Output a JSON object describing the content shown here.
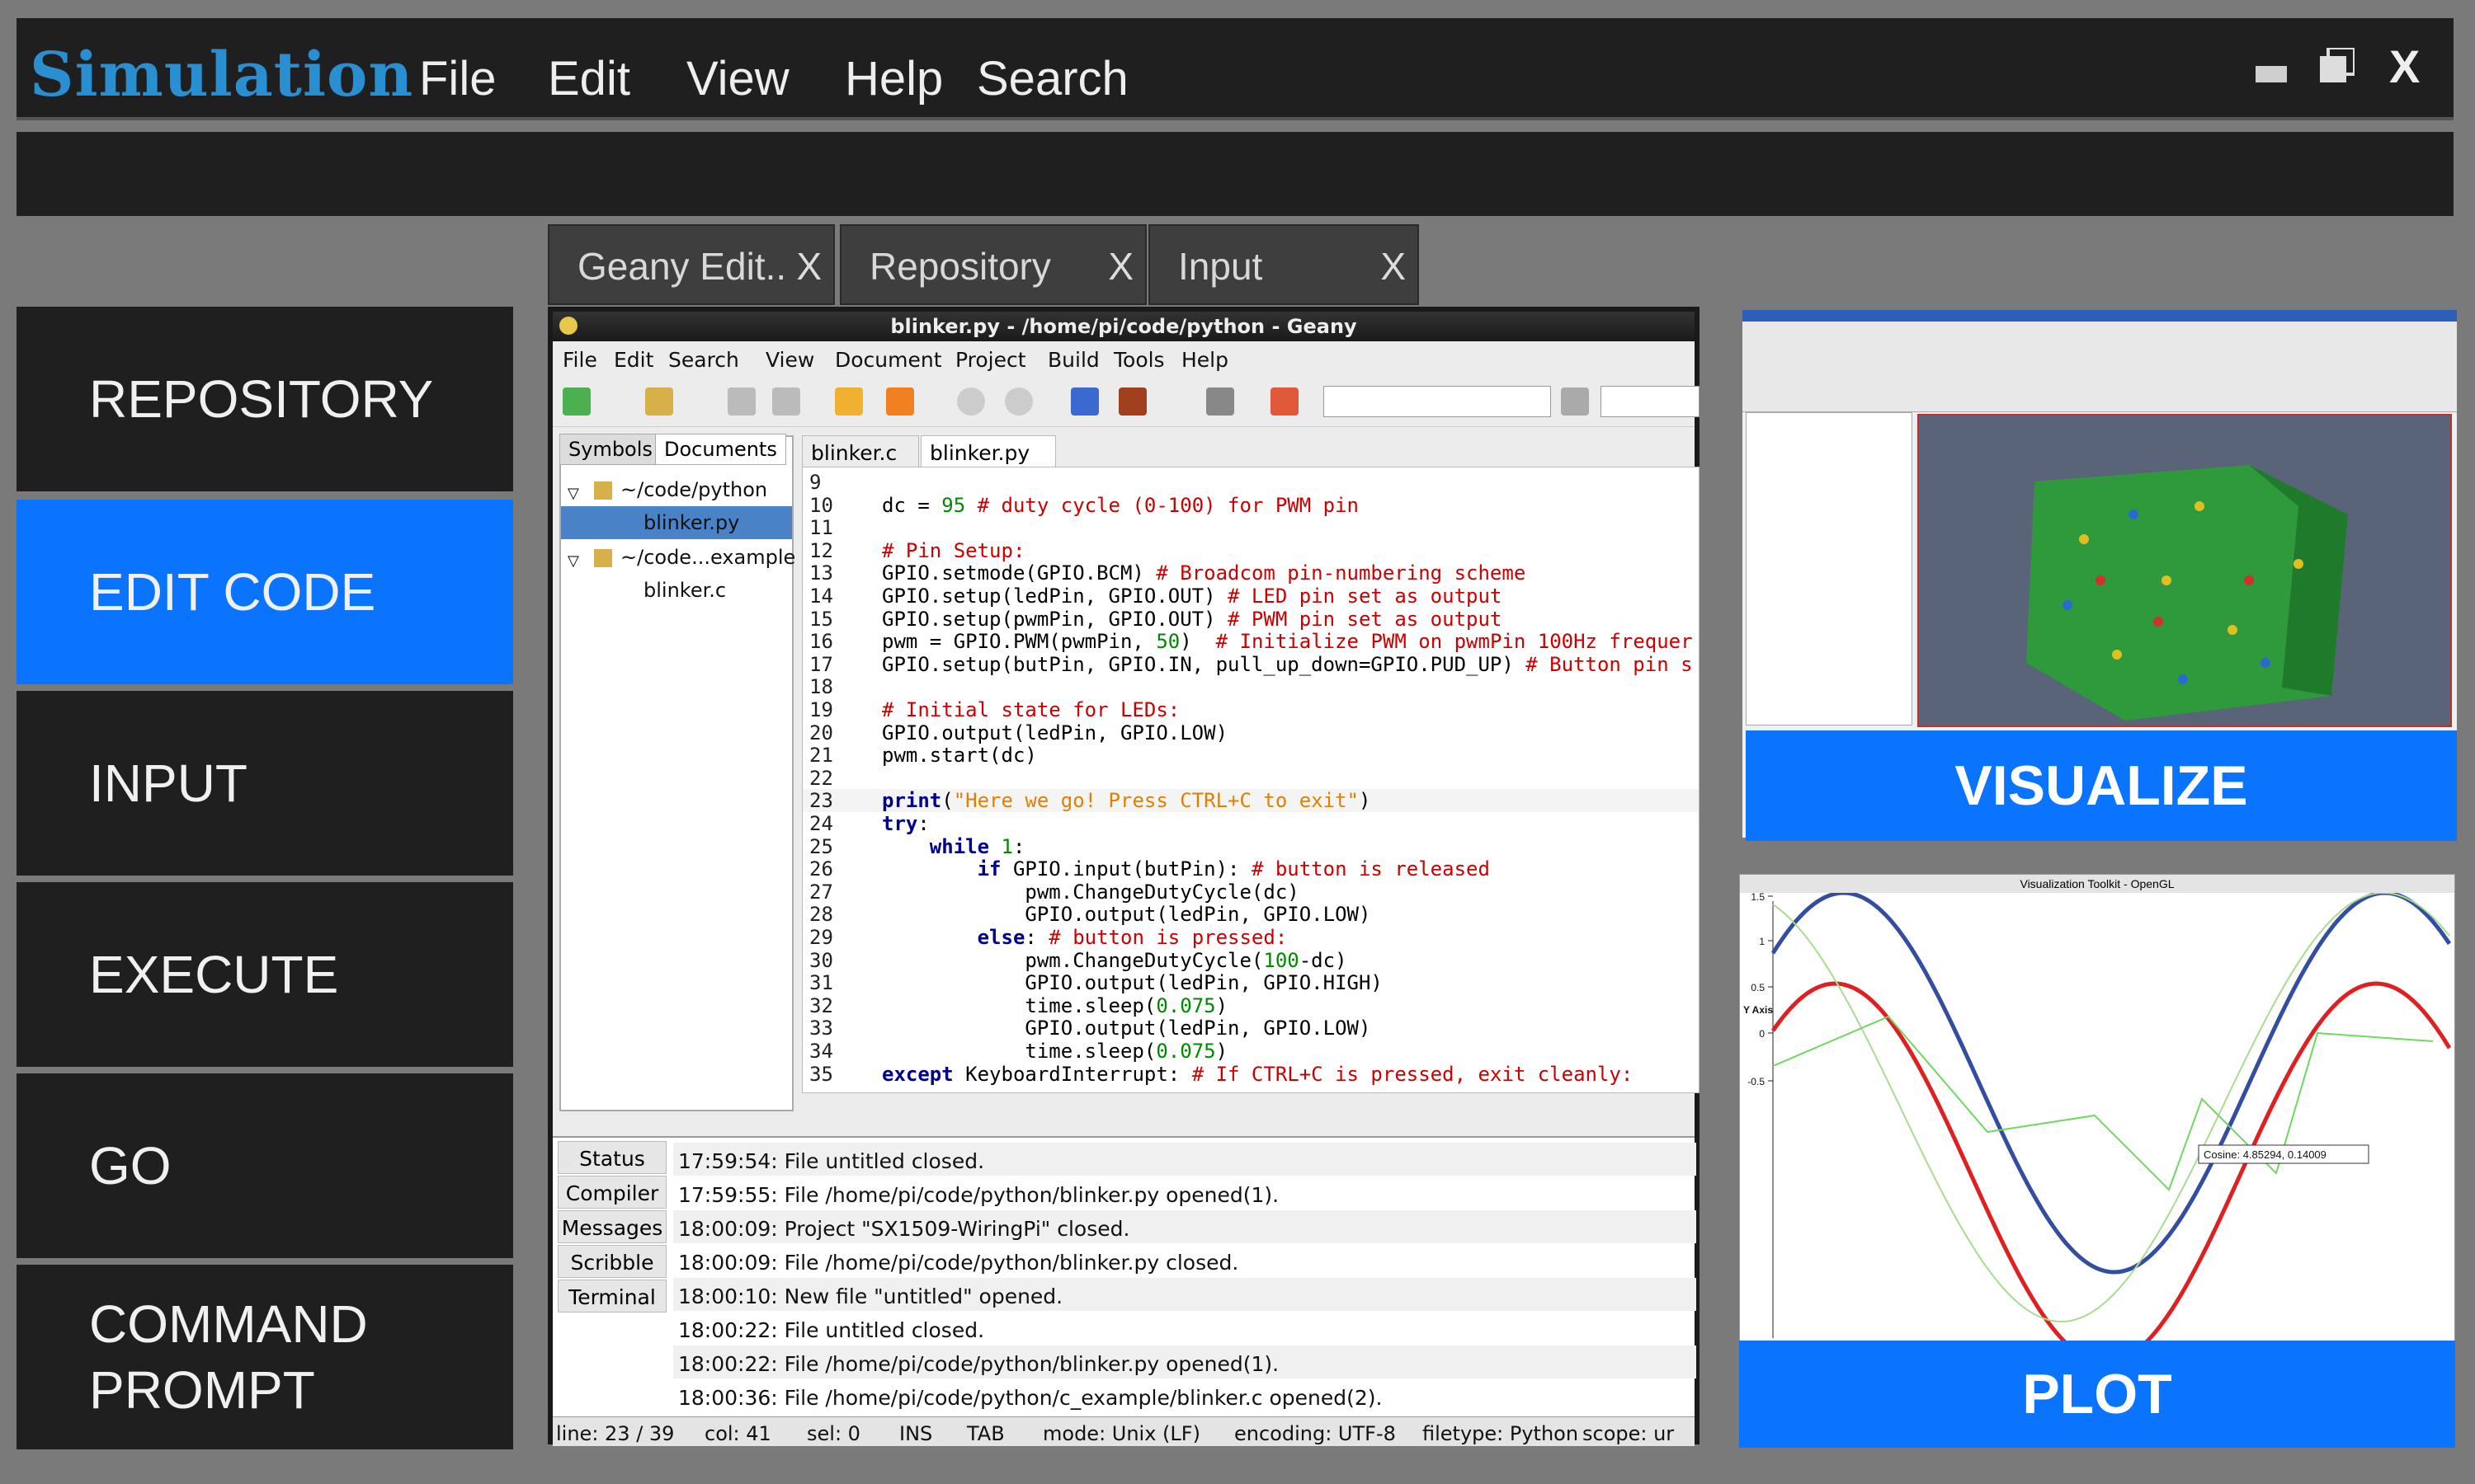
{
  "app": {
    "logo": "Simulation",
    "menu": [
      "File",
      "Edit",
      "View",
      "Help",
      "Search"
    ],
    "close": "X"
  },
  "tabs": [
    {
      "label": "Geany Edit..",
      "close": "X"
    },
    {
      "label": "Repository",
      "close": "X"
    },
    {
      "label": "Input",
      "close": "X"
    }
  ],
  "sidebar": {
    "items": [
      {
        "label": "REPOSITORY"
      },
      {
        "label": "EDIT CODE"
      },
      {
        "label": "INPUT"
      },
      {
        "label": "EXECUTE"
      },
      {
        "label": "GO"
      },
      {
        "label": "COMMAND PROMPT"
      }
    ],
    "active": 1
  },
  "editor": {
    "title": "blinker.py - /home/pi/code/python - Geany",
    "menu": [
      "File",
      "Edit",
      "Search",
      "View",
      "Document",
      "Project",
      "Build",
      "Tools",
      "Help"
    ],
    "side_tabs": [
      "Symbols",
      "Documents"
    ],
    "tree": [
      {
        "label": "~/code/python",
        "kind": "folder"
      },
      {
        "label": "blinker.py",
        "kind": "file",
        "selected": true
      },
      {
        "label": "~/code...example",
        "kind": "folder"
      },
      {
        "label": "blinker.c",
        "kind": "file"
      }
    ],
    "file_tabs": [
      "blinker.c",
      "blinker.py"
    ],
    "lines": [
      {
        "n": "9",
        "t": ""
      },
      {
        "n": "10",
        "t": "dc = 95 # duty cycle (0-100) for PWM pin"
      },
      {
        "n": "11",
        "t": ""
      },
      {
        "n": "12",
        "t": "# Pin Setup:"
      },
      {
        "n": "13",
        "t": "GPIO.setmode(GPIO.BCM) # Broadcom pin-numbering scheme"
      },
      {
        "n": "14",
        "t": "GPIO.setup(ledPin, GPIO.OUT) # LED pin set as output"
      },
      {
        "n": "15",
        "t": "GPIO.setup(pwmPin, GPIO.OUT) # PWM pin set as output"
      },
      {
        "n": "16",
        "t": "pwm = GPIO.PWM(pwmPin, 50)  # Initialize PWM on pwmPin 100Hz frequer"
      },
      {
        "n": "17",
        "t": "GPIO.setup(butPin, GPIO.IN, pull_up_down=GPIO.PUD_UP) # Button pin s"
      },
      {
        "n": "18",
        "t": ""
      },
      {
        "n": "19",
        "t": "# Initial state for LEDs:"
      },
      {
        "n": "20",
        "t": "GPIO.output(ledPin, GPIO.LOW)"
      },
      {
        "n": "21",
        "t": "pwm.start(dc)"
      },
      {
        "n": "22",
        "t": ""
      },
      {
        "n": "23",
        "t": "print(\"Here we go! Press CTRL+C to exit\")"
      },
      {
        "n": "24",
        "t": "try:"
      },
      {
        "n": "25",
        "t": "    while 1:"
      },
      {
        "n": "26",
        "t": "        if GPIO.input(butPin): # button is released"
      },
      {
        "n": "27",
        "t": "            pwm.ChangeDutyCycle(dc)"
      },
      {
        "n": "28",
        "t": "            GPIO.output(ledPin, GPIO.LOW)"
      },
      {
        "n": "29",
        "t": "        else: # button is pressed:"
      },
      {
        "n": "30",
        "t": "            pwm.ChangeDutyCycle(100-dc)"
      },
      {
        "n": "31",
        "t": "            GPIO.output(ledPin, GPIO.HIGH)"
      },
      {
        "n": "32",
        "t": "            time.sleep(0.075)"
      },
      {
        "n": "33",
        "t": "            GPIO.output(ledPin, GPIO.LOW)"
      },
      {
        "n": "34",
        "t": "            time.sleep(0.075)"
      },
      {
        "n": "35",
        "t": "except KeyboardInterrupt: # If CTRL+C is pressed, exit cleanly:"
      }
    ],
    "msg_tabs": [
      "Status",
      "Compiler",
      "Messages",
      "Scribble",
      "Terminal"
    ],
    "messages": [
      "17:59:54: File untitled closed.",
      "17:59:55: File /home/pi/code/python/blinker.py opened(1).",
      "18:00:09: Project \"SX1509-WiringPi\" closed.",
      "18:00:09: File /home/pi/code/python/blinker.py closed.",
      "18:00:10: New file \"untitled\" opened.",
      "18:00:22: File untitled closed.",
      "18:00:22: File /home/pi/code/python/blinker.py opened(1).",
      "18:00:36: File /home/pi/code/python/c_example/blinker.c opened(2)."
    ],
    "status": {
      "line": "line: 23 / 39",
      "col": "col: 41",
      "sel": "sel: 0",
      "ins": "INS",
      "tab": "TAB",
      "mode": "mode: Unix (LF)",
      "encoding": "encoding: UTF-8",
      "filetype": "filetype: Python",
      "scope": "scope: ur"
    }
  },
  "visualize": {
    "label": "VISUALIZE"
  },
  "plot": {
    "label": "PLOT",
    "window_title": "Visualization Toolkit - OpenGL",
    "y_ticks": [
      "1.5",
      "1",
      "0.5",
      "0",
      "-0.5"
    ],
    "y_axis_label": "Y Axis",
    "tooltip": "Cosine: 4.85294, 0.14009"
  }
}
